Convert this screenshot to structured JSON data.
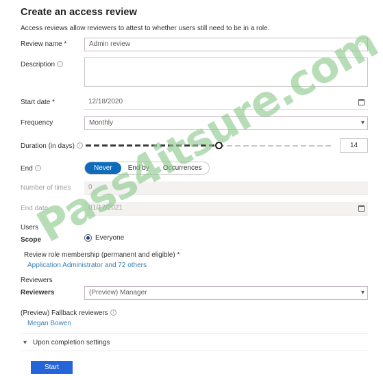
{
  "page": {
    "title": "Create an access review",
    "subtitle": "Access reviews allow reviewers to attest to whether users still need to be in a role."
  },
  "fields": {
    "review_name": {
      "label": "Review name *",
      "value": "Admin review",
      "validation_icon": "check-icon"
    },
    "description": {
      "label": "Description",
      "value": "",
      "info_icon": "info-icon"
    },
    "start_date": {
      "label": "Start date *",
      "value": "12/18/2020",
      "calendar_icon": "calendar-icon"
    },
    "frequency": {
      "label": "Frequency",
      "value": "Monthly",
      "chevron_icon": "chevron-down-icon"
    },
    "duration": {
      "label": "Duration (in days)",
      "info_icon": "info-icon",
      "value": "14",
      "fill_percent": 54
    },
    "end": {
      "label": "End",
      "info_icon": "info-icon",
      "options": [
        "Never",
        "End by",
        "Occurrences"
      ],
      "selected": "Never"
    },
    "number_of_times": {
      "label": "Number of times",
      "value": "0",
      "disabled": true
    },
    "end_date": {
      "label": "End date",
      "value": "01/17/2021",
      "disabled": true,
      "calendar_icon": "calendar-icon"
    }
  },
  "users": {
    "section_label": "Users",
    "scope_label": "Scope",
    "scope_options": [
      "Everyone"
    ],
    "scope_selected": "Everyone",
    "role_membership_label": "Review role membership (permanent and eligible) *",
    "role_membership_link": "Application Administrator and 72 others"
  },
  "reviewers": {
    "section_label": "Reviewers",
    "field_label": "Reviewers",
    "value": "(Preview) Manager",
    "chevron_icon": "chevron-down-icon",
    "fallback_label": "(Preview) Fallback reviewers",
    "fallback_info_icon": "info-icon",
    "fallback_value": "Megan Bowen"
  },
  "accordion": {
    "label": "Upon completion settings",
    "chevron_icon": "chevron-down-icon"
  },
  "actions": {
    "start_label": "Start"
  },
  "watermark": {
    "text": "Pass4itsure.com"
  },
  "colors": {
    "accent": "#0f6cbd",
    "start_button": "#2464d8",
    "link": "#3b7fb5",
    "watermark": "#8cc98c",
    "field_border": "#c8b6c4"
  }
}
